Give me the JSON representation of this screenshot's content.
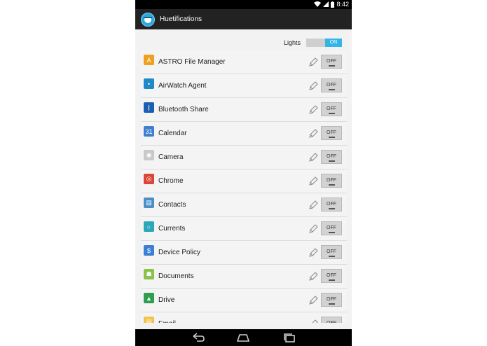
{
  "status": {
    "time": "8:42",
    "wifi_icon": "wifi-icon",
    "signal_icon": "signal-icon",
    "battery_icon": "battery-icon"
  },
  "app": {
    "title": "Huetifications",
    "icon": "huetifications-app-icon"
  },
  "lights": {
    "label": "Lights",
    "state": "ON"
  },
  "apps": [
    {
      "name": "ASTRO File Manager",
      "icon": "astro-icon",
      "color": "#f0a020",
      "glyph": "A",
      "toggle": "OFF"
    },
    {
      "name": "AirWatch Agent",
      "icon": "airwatch-icon",
      "color": "#1e88c8",
      "glyph": "•",
      "toggle": "OFF"
    },
    {
      "name": "Bluetooth Share",
      "icon": "bluetooth-icon",
      "color": "#1c5fb0",
      "glyph": "ᛒ",
      "toggle": "OFF"
    },
    {
      "name": "Calendar",
      "icon": "calendar-icon",
      "color": "#3f7fd0",
      "glyph": "31",
      "toggle": "OFF"
    },
    {
      "name": "Camera",
      "icon": "camera-icon",
      "color": "#c9c9c9",
      "glyph": "◉",
      "toggle": "OFF"
    },
    {
      "name": "Chrome",
      "icon": "chrome-icon",
      "color": "#db4437",
      "glyph": "◎",
      "toggle": "OFF"
    },
    {
      "name": "Contacts",
      "icon": "contacts-icon",
      "color": "#4a90c8",
      "glyph": "▤",
      "toggle": "OFF"
    },
    {
      "name": "Currents",
      "icon": "currents-icon",
      "color": "#2ba7b8",
      "glyph": "○",
      "toggle": "OFF"
    },
    {
      "name": "Device Policy",
      "icon": "device-policy-icon",
      "color": "#3c7fd4",
      "glyph": "$",
      "toggle": "OFF"
    },
    {
      "name": "Documents",
      "icon": "documents-android-icon",
      "color": "#8bc34a",
      "glyph": "☗",
      "toggle": "OFF"
    },
    {
      "name": "Drive",
      "icon": "drive-icon",
      "color": "#2f9e4f",
      "glyph": "▲",
      "toggle": "OFF"
    },
    {
      "name": "Email",
      "icon": "email-icon",
      "color": "#f2c24a",
      "glyph": "✉",
      "toggle": "OFF"
    }
  ],
  "nav": {
    "back_icon": "back-icon",
    "home_icon": "home-icon",
    "recents_icon": "recents-icon"
  }
}
